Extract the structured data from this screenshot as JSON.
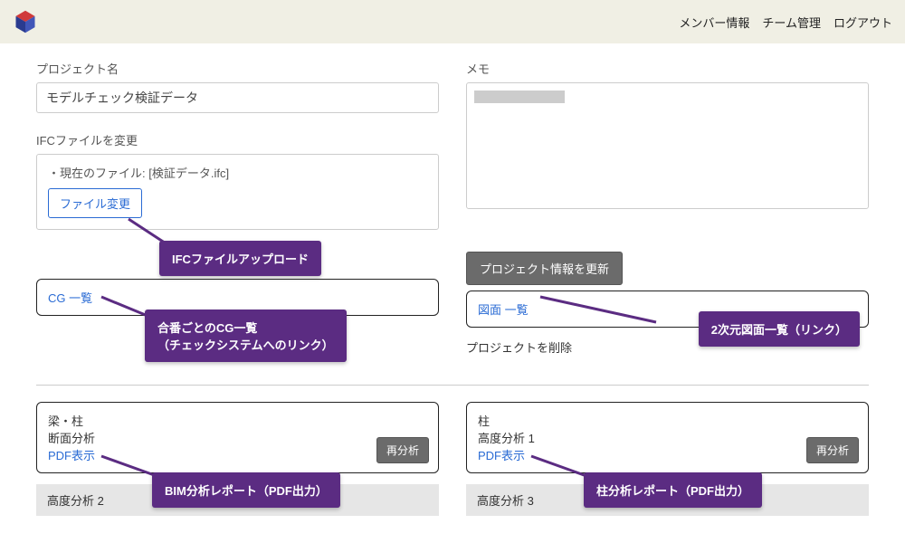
{
  "nav": {
    "members": "メンバー情報",
    "team": "チーム管理",
    "logout": "ログアウト"
  },
  "project": {
    "name_label": "プロジェクト名",
    "name_value": "モデルチェック検証データ",
    "memo_label": "メモ",
    "ifc_label": "IFCファイルを変更",
    "current_file_line": "・現在のファイル: [検証データ.ifc]",
    "change_file_btn": "ファイル変更",
    "update_btn": "プロジェクト情報を更新",
    "delete_btn": "プロジェクトを削除"
  },
  "links": {
    "cg": "CG 一覧",
    "drawing": "図面 一覧"
  },
  "cards": {
    "left": {
      "title": "梁・柱",
      "sub": "断面分析",
      "pdf": "PDF表示",
      "re": "再分析"
    },
    "right": {
      "title": "柱",
      "sub": "高度分析 1",
      "pdf": "PDF表示",
      "re": "再分析"
    },
    "extra_left": "高度分析 2",
    "extra_right": "高度分析 3"
  },
  "callouts": {
    "upload": "IFCファイルアップロード",
    "cg": "合番ごとのCG一覧\n（チェックシステムへのリンク）",
    "drawing": "2次元図面一覧（リンク）",
    "bim": "BIM分析レポート（PDF出力）",
    "col": "柱分析レポート（PDF出力）"
  }
}
